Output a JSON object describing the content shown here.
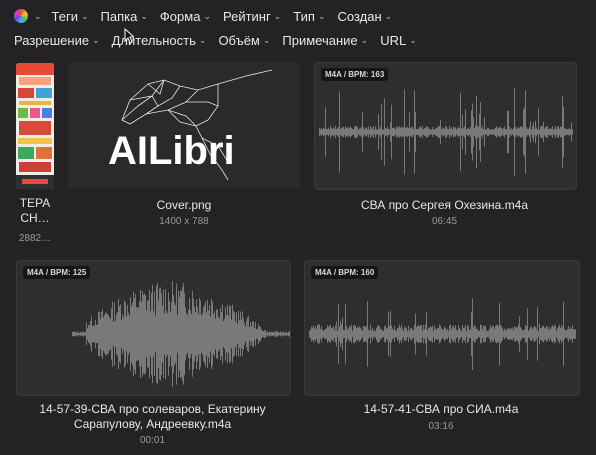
{
  "filters": {
    "row1": [
      {
        "label": "Теги"
      },
      {
        "label": "Папка"
      },
      {
        "label": "Форма"
      },
      {
        "label": "Рейтинг"
      },
      {
        "label": "Тип"
      },
      {
        "label": "Создан"
      }
    ],
    "row2": [
      {
        "label": "Разрешение"
      },
      {
        "label": "Длительность"
      },
      {
        "label": "Объём"
      },
      {
        "label": "Примечание"
      },
      {
        "label": "URL"
      }
    ]
  },
  "items": [
    {
      "title": "ТЕРА\nСН…",
      "meta": "2882…"
    },
    {
      "title": "Cover.png",
      "meta": "1400 x 788",
      "logo_text": "AILibri"
    },
    {
      "title": "СВА про Сергея Охезина.m4a",
      "meta": "06:45",
      "badge": "M4A / BPM: 163"
    },
    {
      "title": "14-57-39-СВА про солеваров, Екатерину Сарапулову, Андреевку.m4a",
      "meta": "00:01",
      "badge": "M4A / BPM: 125"
    },
    {
      "title": "14-57-41-СВА про СИА.m4a",
      "meta": "03:16",
      "badge": "M4A / BPM: 160"
    }
  ],
  "colors": {
    "background": "#232325",
    "waveform": "#9a9a9a",
    "thumbnail_bg": "#2e2e30"
  }
}
